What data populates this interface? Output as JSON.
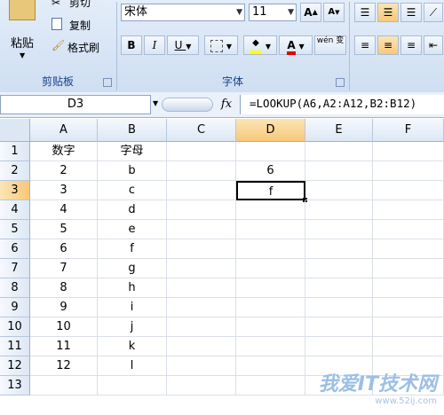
{
  "ribbon": {
    "clipboard": {
      "paste_label": "粘贴",
      "cut_label": "剪切",
      "copy_label": "复制",
      "format_painter_label": "格式刷",
      "group_label": "剪贴板"
    },
    "font": {
      "font_name": "宋体",
      "font_size": "11",
      "grow_label": "A",
      "shrink_label": "A",
      "bold_label": "B",
      "italic_label": "I",
      "underline_label": "U",
      "font_color_label": "A",
      "phonetic_label": "wén 变",
      "group_label": "字体"
    }
  },
  "formula_bar": {
    "name_box": "D3",
    "fx_label": "fx",
    "formula": "=LOOKUP(A6,A2:A12,B2:B12)"
  },
  "sheet": {
    "columns": [
      "A",
      "B",
      "C",
      "D",
      "E",
      "F"
    ],
    "rows": [
      "1",
      "2",
      "3",
      "4",
      "5",
      "6",
      "7",
      "8",
      "9",
      "10",
      "11",
      "12",
      "13"
    ],
    "header_A": "数字",
    "header_B": "字母",
    "data": [
      {
        "a": "2",
        "b": "b",
        "d": "6"
      },
      {
        "a": "3",
        "b": "c",
        "d": "f"
      },
      {
        "a": "4",
        "b": "d",
        "d": ""
      },
      {
        "a": "5",
        "b": "e",
        "d": ""
      },
      {
        "a": "6",
        "b": "f",
        "d": ""
      },
      {
        "a": "7",
        "b": "g",
        "d": ""
      },
      {
        "a": "8",
        "b": "h",
        "d": ""
      },
      {
        "a": "9",
        "b": "i",
        "d": ""
      },
      {
        "a": "10",
        "b": "j",
        "d": ""
      },
      {
        "a": "11",
        "b": "k",
        "d": ""
      },
      {
        "a": "12",
        "b": "l",
        "d": ""
      }
    ],
    "active_cell": "D3"
  },
  "watermark": {
    "main": "我爱IT技术网",
    "sub": "www.52ij.com"
  }
}
